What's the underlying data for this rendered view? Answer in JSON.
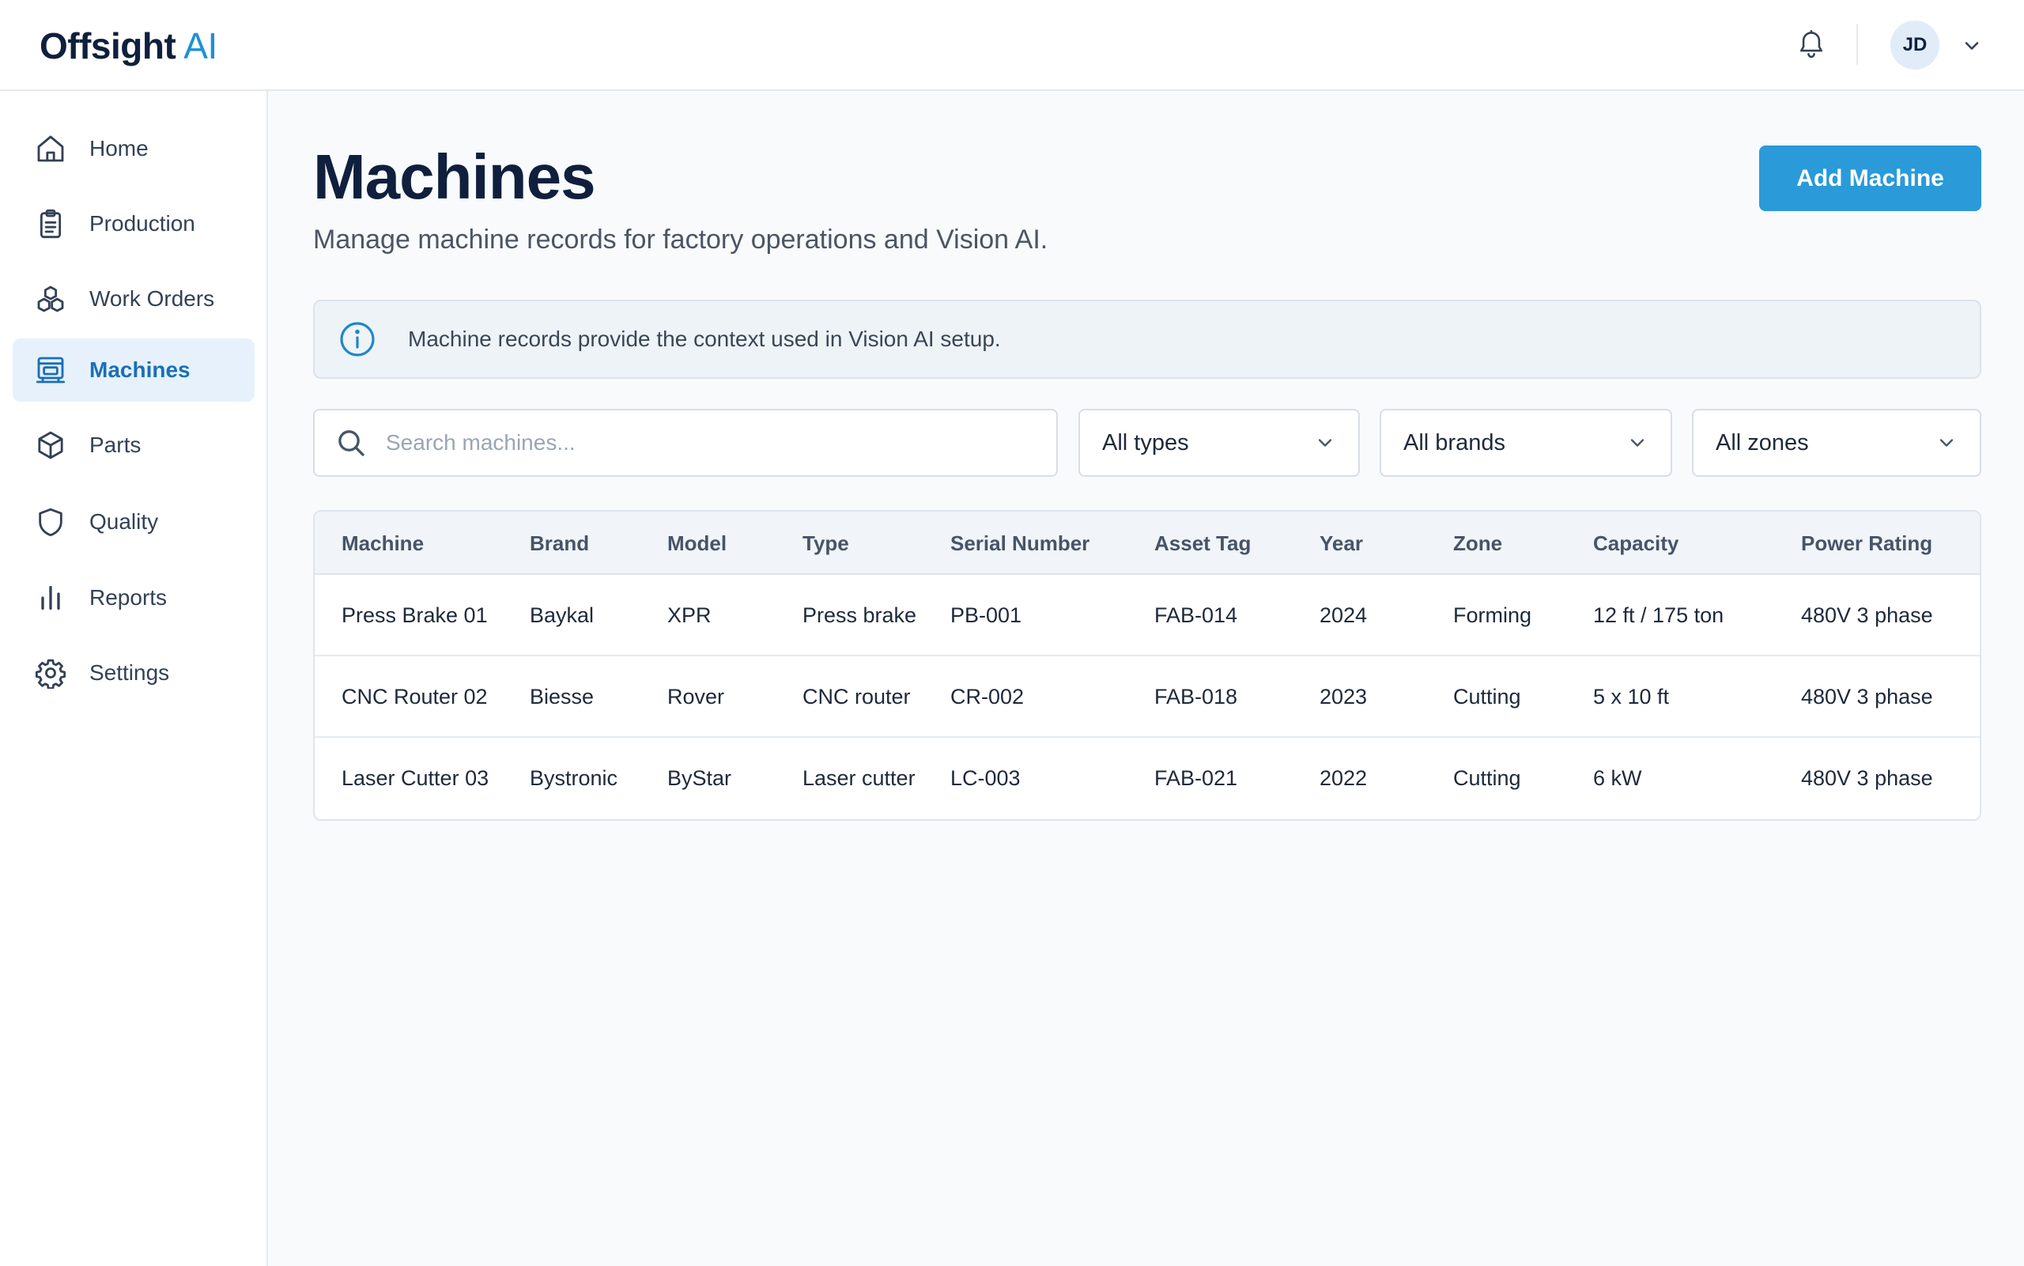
{
  "brand": {
    "name": "Offsight",
    "suffix": "AI"
  },
  "header": {
    "avatar_initials": "JD"
  },
  "sidebar": {
    "items": [
      {
        "label": "Home",
        "icon": "home-icon"
      },
      {
        "label": "Production",
        "icon": "clipboard-icon"
      },
      {
        "label": "Work Orders",
        "icon": "boxes-icon"
      },
      {
        "label": "Machines",
        "icon": "machine-icon",
        "active": true
      },
      {
        "label": "Parts",
        "icon": "cube-icon"
      },
      {
        "label": "Quality",
        "icon": "shield-icon"
      },
      {
        "label": "Reports",
        "icon": "bar-chart-icon"
      },
      {
        "label": "Settings",
        "icon": "gear-icon"
      }
    ]
  },
  "main": {
    "title": "Machines",
    "subtitle": "Manage machine records for factory operations and Vision AI.",
    "add_button": "Add Machine",
    "info_text": "Machine records provide the context used in Vision AI setup.",
    "search_placeholder": "Search machines...",
    "filters": {
      "types": "All types",
      "brands": "All brands",
      "zones": "All zones"
    }
  },
  "table": {
    "headers": [
      "Machine",
      "Brand",
      "Model",
      "Type",
      "Serial Number",
      "Asset Tag",
      "Year",
      "Zone",
      "Capacity",
      "Power Rating"
    ],
    "rows": [
      [
        "Press Brake 01",
        "Baykal",
        "XPR",
        "Press brake",
        "PB-001",
        "FAB-014",
        "2024",
        "Forming",
        "12 ft / 175 ton",
        "480V 3 phase"
      ],
      [
        "CNC Router 02",
        "Biesse",
        "Rover",
        "CNC router",
        "CR-002",
        "FAB-018",
        "2023",
        "Cutting",
        "5 x 10 ft",
        "480V 3 phase"
      ],
      [
        "Laser Cutter 03",
        "Bystronic",
        "ByStar",
        "Laser cutter",
        "LC-003",
        "FAB-021",
        "2022",
        "Cutting",
        "6 kW",
        "480V 3 phase"
      ]
    ]
  },
  "colors": {
    "accent": "#2a9ad9",
    "active_nav_bg": "#e6f1fb",
    "active_nav_text": "#1b6fb5",
    "brand_dark": "#0f1f3d"
  }
}
